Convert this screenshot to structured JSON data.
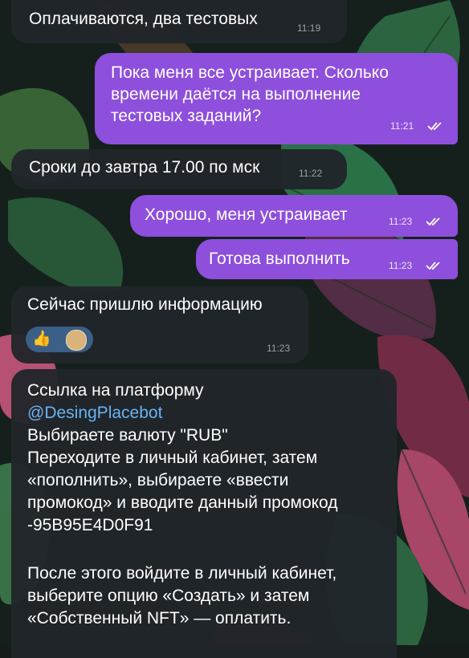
{
  "messages": {
    "m1": {
      "text": "Оплачиваются, два тестовых",
      "time": "11:19"
    },
    "m2": {
      "lines": [
        "Пока меня все устраивает. Сколько",
        "времени даётся на выполнение",
        "тестовых заданий?"
      ],
      "time": "11:21"
    },
    "m3": {
      "text": "Сроки до завтра 17.00 по мск",
      "time": "11:22"
    },
    "m4": {
      "text": "Хорошо, меня устраивает",
      "time": "11:23"
    },
    "m5": {
      "text": "Готова выполнить",
      "time": "11:23"
    },
    "m6": {
      "text": "Сейчас пришлю информацию",
      "time": "11:23",
      "reaction": "👍"
    },
    "m7": {
      "line1": "Ссылка на платформу",
      "link": "@DesingPlacebot",
      "lines": [
        "Выбираете валюту \"RUB\"",
        "Переходите в личный кабинет, затем",
        "«пополнить», выбираете «ввести",
        "промокод» и вводите данный промокод",
        "-95B95E4D0F91"
      ],
      "lines2": [
        "После этого войдите в личный кабинет,",
        "выберите опцию «Создать» и затем",
        "«Собственный NFT» — оплатить."
      ]
    }
  },
  "colors": {
    "incoming": "#21252b",
    "outgoing": "#8e4fdc",
    "link": "#6ab3f3"
  }
}
